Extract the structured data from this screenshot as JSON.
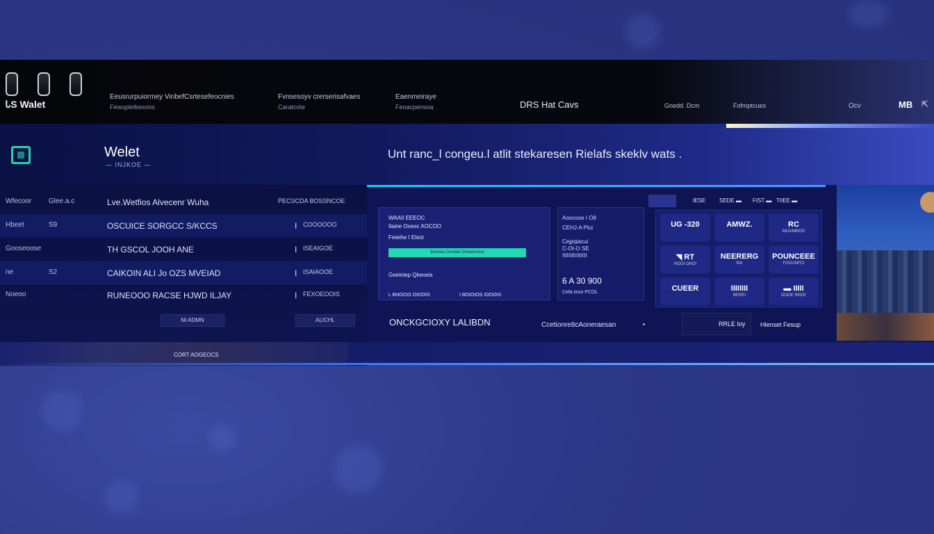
{
  "topbar": {
    "brand": "ᏓS  Walet",
    "nav": [
      {
        "label": "Eeusrurpuiormey VinbefCsrtesefeocnies",
        "sub": "Fewupletkesons"
      },
      {
        "label": "Fvnsesoyv crerserisafvaes",
        "sub": "Caratcote"
      },
      {
        "label": "Eaenmeiraye",
        "sub": "Feoacpensoa"
      }
    ],
    "main": "DRS  Hat Cavs",
    "links": [
      "Gnedd.  Dcm",
      "Fofmptcues",
      "Ocv"
    ],
    "right": "MB",
    "arrow": "⇱"
  },
  "header": {
    "title": "Welet",
    "subtitle": "— INJKOE —",
    "headline": "Unt ranc_l congeu.l atlit stekaresen Rielafs skeklv wats ."
  },
  "left_list": {
    "rows": [
      {
        "c1": "Wfecoor",
        "c2": "Glee.a.c",
        "c3": "Lve.Wetfios  Alvecenr Wuha",
        "c4": "",
        "c5": "PECSCDA  BOSSNCOE"
      },
      {
        "c1": "Hbeet",
        "c2": "S9",
        "c3": "OSCUICE  SORGCC  S/KCCS",
        "c4": "I",
        "c5": "COOOOOO"
      },
      {
        "c1": "Gooseoose",
        "c2": "",
        "c3": "TH GSCOL     JOOH ANE",
        "c4": "I",
        "c5": "ISEAIGOE"
      },
      {
        "c1": "ne",
        "c2": "S2",
        "c3": "CAIKOIN  ALI Jo  OZS   MVEIAD",
        "c4": "I",
        "c5": "ISAIAOOE"
      },
      {
        "c1": "Noeoo",
        "c2": "",
        "c3": "RUNEOOO  RACSE HJWD  ILJAY",
        "c4": "I",
        "c5": "FEXOEOOIS"
      }
    ],
    "btn1": "NI ADMN",
    "btn2": "ALICHL",
    "strip": "CORT  AOGEOCS"
  },
  "card_a": {
    "l1": "WAAII  EEEOC",
    "l2": "Ilaine  Oxeoc  AOCOO",
    "l3": "Feieihe   I   Elsot",
    "progress": "Dixceia Cuxnitei Oxnaosrouo",
    "l4": "Geeiniep  Qkeoeis",
    "f1": "L BNOOIS  OIOOIS",
    "f2": "I BOIOIOS  IOOOIS"
  },
  "card_b": {
    "l1": "Aoocooe  I  O8",
    "l2": "CEHJ-A  Plui",
    "l3": "Cejpqiacui",
    "l4": "C-OI-O  SE",
    "l5": "IIIIIIIIIIIIIIII",
    "value": "6 A 30  900",
    "foot": "Cefa Ieuo  PCOL"
  },
  "grid_hdr": [
    "IESE",
    "SEDE  ▬",
    "FIST  ▬",
    "TIIEE  ▬"
  ],
  "tiles": [
    {
      "t": "UG -320",
      "s": ""
    },
    {
      "t": "AMWZ.",
      "s": ""
    },
    {
      "t": "RC",
      "s": "MIJANBIOS"
    },
    {
      "t": "◥ RT",
      "s": "HOOI  OHOI"
    },
    {
      "t": "NEERERG",
      "s": "PAI"
    },
    {
      "t": "POUNCEEE",
      "s": "FOOUNFCI"
    },
    {
      "t": "CUEER",
      "s": ""
    },
    {
      "t": "IIIIIIII",
      "s": "BEREI"
    },
    {
      "t": "▬  IIIII",
      "s": "DOOE REEE"
    }
  ],
  "bottom": {
    "main": "ONCKGCIOXY  LALIBDN",
    "mid": "Ccetionre8cAoneraesan",
    "box": "RRLE  Ioy",
    "link": "Hlenset  Fesup"
  },
  "colors": {
    "accent": "#1fd6a8",
    "bg": "#2d3a8c",
    "panel": "#0f1554",
    "highlight": "#1ec8ff"
  }
}
